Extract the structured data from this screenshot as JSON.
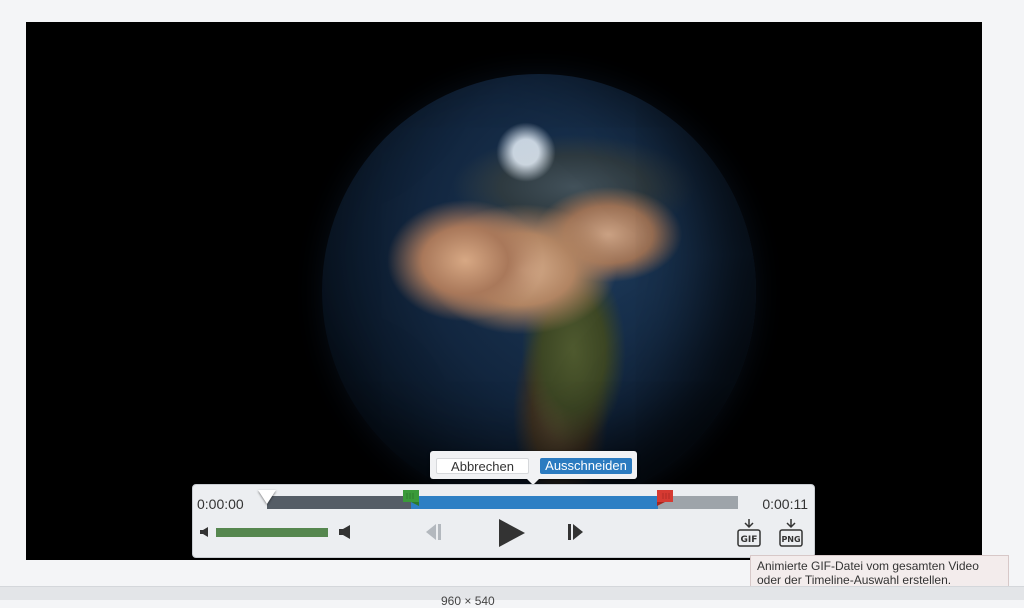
{
  "player": {
    "time_start": "0:00:00",
    "time_end": "0:00:11",
    "playhead_fraction": 0.0,
    "selection_start_fraction": 0.305,
    "selection_end_fraction": 0.83,
    "volume_fraction": 1.0
  },
  "trim_popup": {
    "cancel_label": "Abbrechen",
    "cut_label": "Ausschneiden"
  },
  "export": {
    "gif_label": "GIF",
    "png_label": "PNG"
  },
  "tooltip": {
    "text": "Animierte GIF-Datei vom gesamten Video oder der Timeline-Auswahl erstellen."
  },
  "statusbar": {
    "resolution": "960 × 540"
  },
  "colors": {
    "accent": "#2b7bc0",
    "selection": "#2d7fc4",
    "volume": "#56874f",
    "start_marker": "#3a9a3a",
    "end_marker": "#d63a32"
  },
  "icons": [
    "volume-low-icon",
    "volume-high-icon",
    "step-back-icon",
    "play-icon",
    "step-forward-icon",
    "export-gif-icon",
    "export-png-icon",
    "trim-start-marker-icon",
    "trim-end-marker-icon"
  ]
}
